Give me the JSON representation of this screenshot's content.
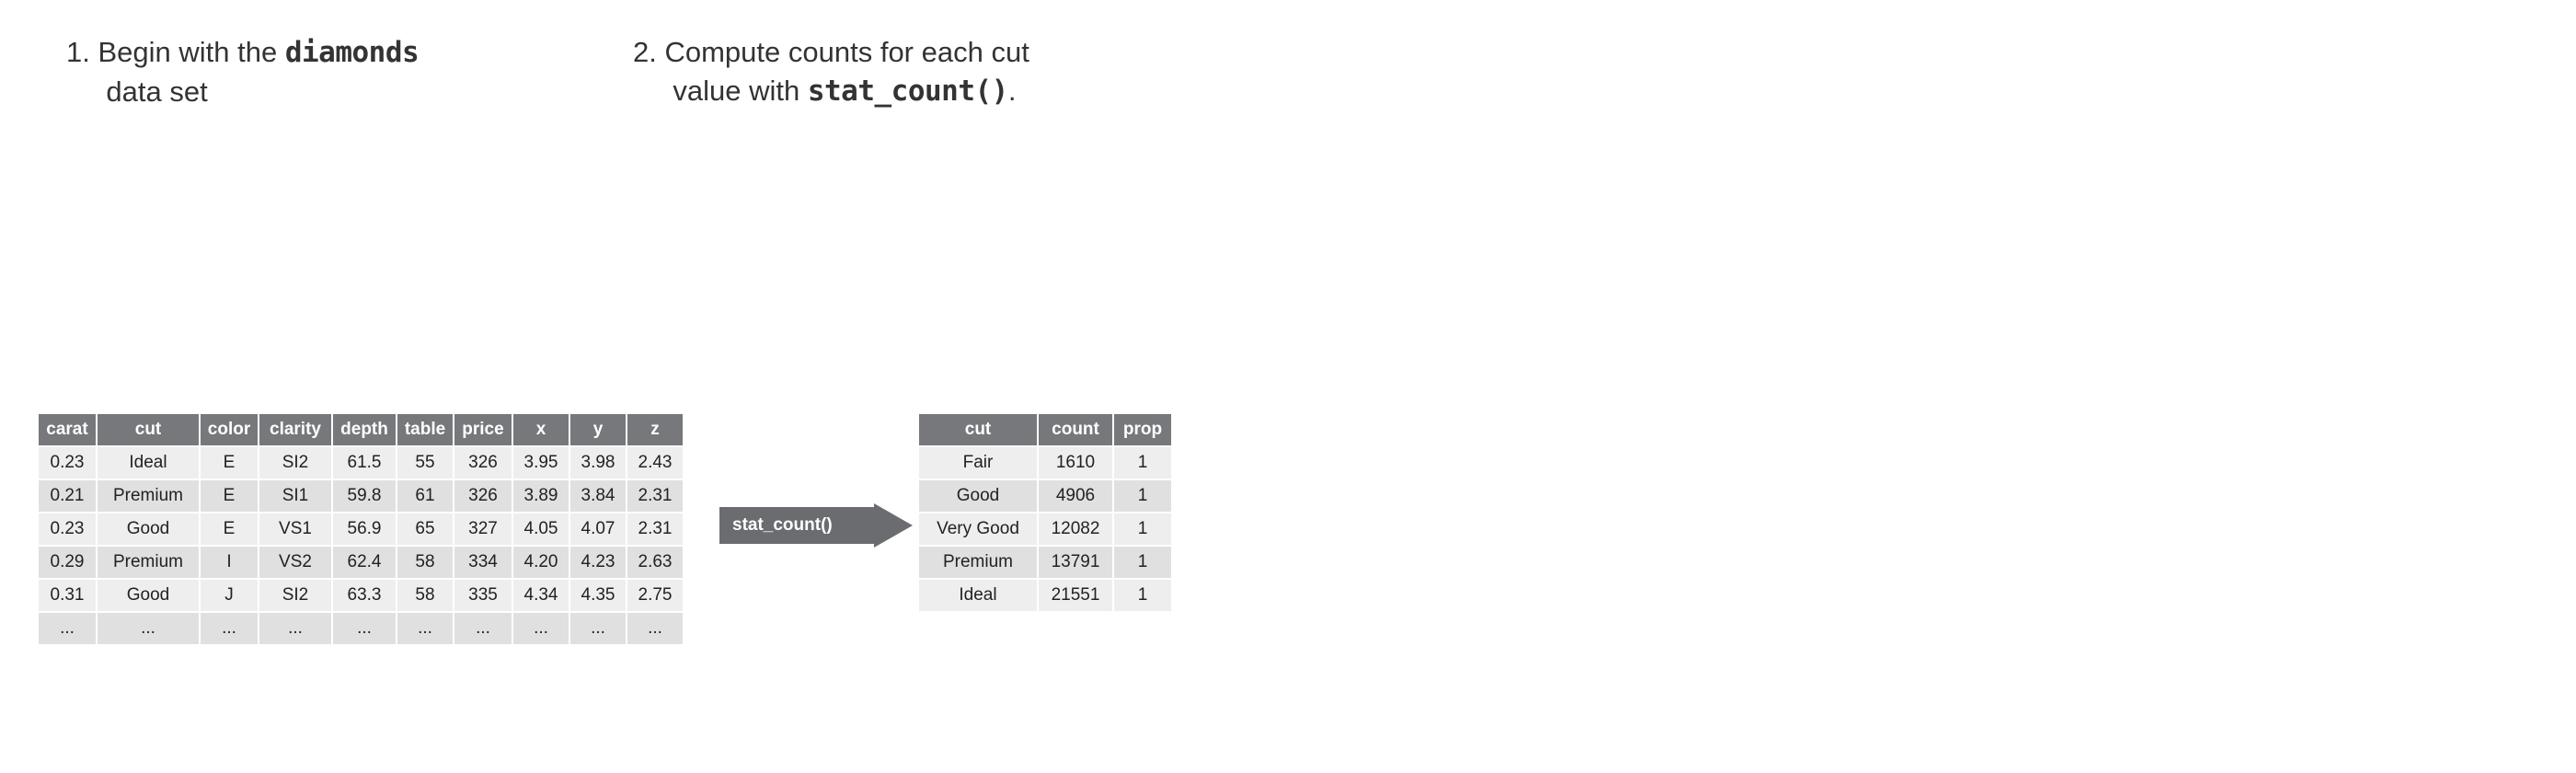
{
  "captions": {
    "step1": {
      "num": "1.",
      "prefix": "Begin with the ",
      "code": "diamonds",
      "line2": "data set"
    },
    "step2": {
      "num": "2.",
      "prefix": "Compute counts for each cut",
      "line2_prefix": "value with ",
      "code": "stat_count()",
      "line2_suffix": "."
    }
  },
  "arrow_label": "stat_count()",
  "diamonds": {
    "headers": [
      "carat",
      "cut",
      "color",
      "clarity",
      "depth",
      "table",
      "price",
      "x",
      "y",
      "z"
    ],
    "rows": [
      [
        "0.23",
        "Ideal",
        "E",
        "SI2",
        "61.5",
        "55",
        "326",
        "3.95",
        "3.98",
        "2.43"
      ],
      [
        "0.21",
        "Premium",
        "E",
        "SI1",
        "59.8",
        "61",
        "326",
        "3.89",
        "3.84",
        "2.31"
      ],
      [
        "0.23",
        "Good",
        "E",
        "VS1",
        "56.9",
        "65",
        "327",
        "4.05",
        "4.07",
        "2.31"
      ],
      [
        "0.29",
        "Premium",
        "I",
        "VS2",
        "62.4",
        "58",
        "334",
        "4.20",
        "4.23",
        "2.63"
      ],
      [
        "0.31",
        "Good",
        "J",
        "SI2",
        "63.3",
        "58",
        "335",
        "4.34",
        "4.35",
        "2.75"
      ],
      [
        "...",
        "...",
        "...",
        "...",
        "...",
        "...",
        "...",
        "...",
        "...",
        "..."
      ]
    ]
  },
  "counts": {
    "headers": [
      "cut",
      "count",
      "prop"
    ],
    "rows": [
      [
        "Fair",
        "1610",
        "1"
      ],
      [
        "Good",
        "4906",
        "1"
      ],
      [
        "Very Good",
        "12082",
        "1"
      ],
      [
        "Premium",
        "13791",
        "1"
      ],
      [
        "Ideal",
        "21551",
        "1"
      ]
    ]
  },
  "chart_data": [
    {
      "type": "table",
      "title": "diamonds",
      "columns": [
        "carat",
        "cut",
        "color",
        "clarity",
        "depth",
        "table",
        "price",
        "x",
        "y",
        "z"
      ],
      "rows": [
        [
          0.23,
          "Ideal",
          "E",
          "SI2",
          61.5,
          55,
          326,
          3.95,
          3.98,
          2.43
        ],
        [
          0.21,
          "Premium",
          "E",
          "SI1",
          59.8,
          61,
          326,
          3.89,
          3.84,
          2.31
        ],
        [
          0.23,
          "Good",
          "E",
          "VS1",
          56.9,
          65,
          327,
          4.05,
          4.07,
          2.31
        ],
        [
          0.29,
          "Premium",
          "I",
          "VS2",
          62.4,
          58,
          334,
          4.2,
          4.23,
          2.63
        ],
        [
          0.31,
          "Good",
          "J",
          "SI2",
          63.3,
          58,
          335,
          4.34,
          4.35,
          2.75
        ]
      ],
      "truncated": true
    },
    {
      "type": "table",
      "title": "stat_count() output",
      "columns": [
        "cut",
        "count",
        "prop"
      ],
      "rows": [
        [
          "Fair",
          1610,
          1
        ],
        [
          "Good",
          4906,
          1
        ],
        [
          "Very Good",
          12082,
          1
        ],
        [
          "Premium",
          13791,
          1
        ],
        [
          "Ideal",
          21551,
          1
        ]
      ]
    }
  ]
}
